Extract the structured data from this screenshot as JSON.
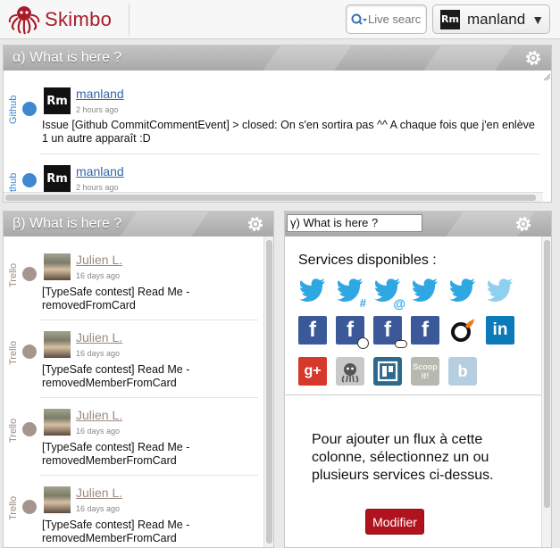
{
  "app": {
    "name": "Skimbo"
  },
  "header": {
    "search": {
      "placeholder": "Live search"
    },
    "user": {
      "avatar_text": "Rm",
      "name": "manland",
      "caret": "▼"
    }
  },
  "panels": {
    "alpha": {
      "title": "α) What is here ?",
      "items": [
        {
          "service": "Github",
          "avatar_text": "Rm",
          "user": "manland",
          "ago": "2 hours ago",
          "text": "Issue [Github CommitCommentEvent] > closed: On s'en sortira pas ^^ A chaque fois que j'en enlève 1 un autre apparaît :D"
        },
        {
          "service": "Github",
          "avatar_text": "Rm",
          "user": "manland",
          "ago": "2 hours ago",
          "text": ""
        }
      ]
    },
    "beta": {
      "title": "β) What is here ?",
      "items": [
        {
          "service": "Trello",
          "user": "Julien L.",
          "ago": "16 days ago",
          "line1": "[TypeSafe contest] Read Me -",
          "line2": "removedFromCard"
        },
        {
          "service": "Trello",
          "user": "Julien L.",
          "ago": "16 days ago",
          "line1": "[TypeSafe contest] Read Me -",
          "line2": "removedMemberFromCard"
        },
        {
          "service": "Trello",
          "user": "Julien L.",
          "ago": "16 days ago",
          "line1": "[TypeSafe contest] Read Me -",
          "line2": "removedMemberFromCard"
        },
        {
          "service": "Trello",
          "user": "Julien L.",
          "ago": "16 days ago",
          "line1": "[TypeSafe contest] Read Me -",
          "line2": "removedMemberFromCard"
        }
      ]
    },
    "gamma": {
      "title_input": "γ) What is here ?",
      "services_title": "Services disponibles :",
      "info_line1": "Pour ajouter un flux à cette",
      "info_line2": "colonne, sélectionnez un ou",
      "info_line3": "plusieurs services ci-dessus.",
      "button": "Modifier",
      "service_badges": {
        "tw_hash": "#",
        "tw_at": "@",
        "gplus": "g+",
        "linkedin": "in",
        "scoopit": "Scoop it!",
        "tumblr_b": "b"
      }
    }
  },
  "colors": {
    "brand": "#a81c2a",
    "github_dot": "#3f87cf",
    "trello_dot": "#a6958f",
    "link_user": "#3366aa",
    "trello_user": "#9a8a80",
    "button": "#b1131e"
  }
}
